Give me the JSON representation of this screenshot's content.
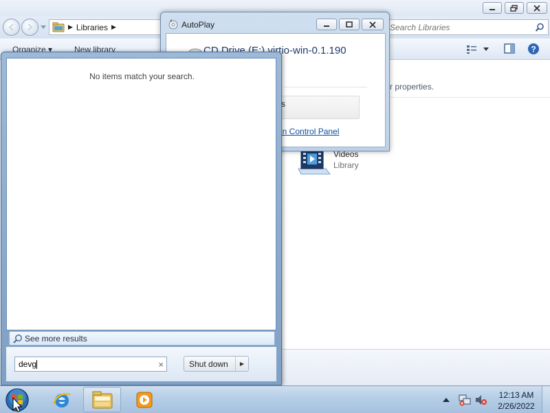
{
  "explorer": {
    "breadcrumb": [
      "Libraries"
    ],
    "search_placeholder": "Search Libraries",
    "toolbar": {
      "organize": "Organize",
      "new_library": "New library"
    },
    "description_partial": "r properties.",
    "videos": {
      "name": "Videos",
      "type": "Library"
    }
  },
  "autoplay": {
    "title": "AutoPlay",
    "drive_label": "CD Drive (E:) virtio-win-0.1.190",
    "option_partial": "s",
    "link_partial": "in Control Panel"
  },
  "start_menu": {
    "no_results": "No items match your search.",
    "see_more": "See more results",
    "search_value": "devg",
    "shutdown_label": "Shut down"
  },
  "taskbar": {
    "time": "12:13 AM",
    "date": "2/26/2022"
  },
  "colors": {
    "accent": "#0a4ea1",
    "taskbar": "#b7cfe7",
    "start_frame": "#8fadd0"
  },
  "icons": [
    "windows-start-orb",
    "internet-explorer-icon",
    "explorer-folder-icon",
    "media-player-icon",
    "network-icon",
    "volume-muted-icon",
    "videos-library-icon",
    "cd-drive-icon",
    "search-icon"
  ]
}
